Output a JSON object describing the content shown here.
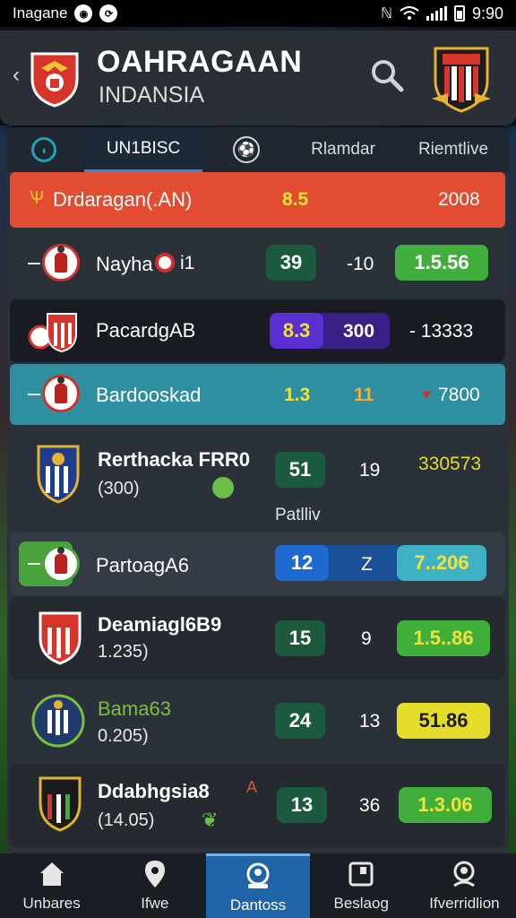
{
  "status_bar": {
    "carrier": "Inagane",
    "time": "9:90"
  },
  "header": {
    "title": "OAHRAGAAN",
    "subtitle": "INDANSIA"
  },
  "tabs": [
    {
      "label": ""
    },
    {
      "label": "UN1BISC"
    },
    {
      "label": ""
    },
    {
      "label": "Rlamdar"
    },
    {
      "label": "Riemtlive"
    }
  ],
  "rows": [
    {
      "name": "Drdaragan(.AN)",
      "col1": "8.5",
      "col2": "",
      "col3": "2008"
    },
    {
      "name": "Nayha",
      "badge": "i1",
      "col1": "39",
      "col2": "-10",
      "col3": "1.5.56"
    },
    {
      "name": "PacardgAB",
      "col1": "8.3",
      "col2": "300",
      "col3": "- 13333"
    },
    {
      "name": "Bardooskad",
      "col1": "1.3",
      "col2": "11",
      "col3": "7800"
    },
    {
      "name": "Rerthacka FRR0",
      "sub": "(300)",
      "col1": "51",
      "col2": "19",
      "col3": "330573",
      "note": "Patlliv"
    },
    {
      "name": "PartoagA6",
      "col1": "12",
      "col2": "Z",
      "col3": "7..206"
    },
    {
      "name": "Deamiagl6B9",
      "sub": "1.235)",
      "col1": "15",
      "col2": "9",
      "col3": "1.5..86"
    },
    {
      "name": "Bama63",
      "sub": "0.205)",
      "col1": "24",
      "col2": "13",
      "col3": "51.86"
    },
    {
      "name": "Ddabhgsia8",
      "sub": "(14.05)",
      "col1": "13",
      "col2": "36",
      "col3": "1.3.06",
      "mark": "A"
    }
  ],
  "bottom_nav": [
    {
      "label": "Unbares",
      "icon": "home-icon"
    },
    {
      "label": "Ifwe",
      "icon": "location-pin-icon"
    },
    {
      "label": "Dantoss",
      "icon": "profile-icon"
    },
    {
      "label": "Beslaog",
      "icon": "document-icon"
    },
    {
      "label": "Ifverridlion",
      "icon": "user-circle-icon"
    }
  ],
  "colors": {
    "accent_red": "#e24d32",
    "active_blue": "#1f64a8",
    "pill_green_dark": "#1c5a3f",
    "pill_green_bright": "#3fae3a",
    "pill_yellow": "#e5dd2a",
    "teal_row": "#2f8fa0"
  }
}
